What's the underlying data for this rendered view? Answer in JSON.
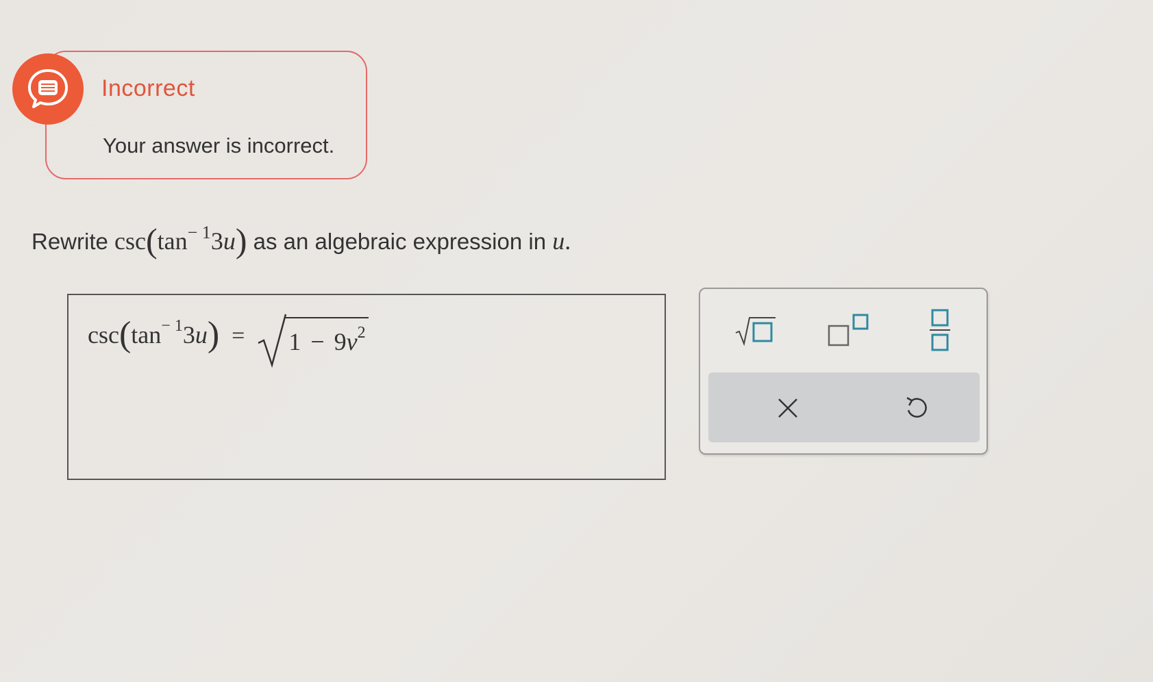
{
  "feedback": {
    "status": "Incorrect",
    "message": "Your answer is incorrect.",
    "icon": "chat-bubble-icon",
    "color": "#ec5a37"
  },
  "question": {
    "prefix": "Rewrite",
    "func": "csc",
    "inner_func": "tan",
    "inner_exp": "− 1",
    "inner_arg_coef": "3",
    "inner_arg_var": "u",
    "suffix": "as an algebraic expression in",
    "var": "u",
    "end": "."
  },
  "answer": {
    "lhs_func": "csc",
    "lhs_inner_func": "tan",
    "lhs_inner_exp": "− 1",
    "lhs_coef": "3",
    "lhs_var": "u",
    "equals": "=",
    "radicand_one": "1",
    "radicand_minus": "−",
    "radicand_coef": "9",
    "radicand_var": "v",
    "radicand_exp": "2"
  },
  "keypad": {
    "keys": [
      "sqrt-icon",
      "superscript-icon",
      "fraction-icon"
    ],
    "actions": [
      "clear-icon",
      "undo-icon"
    ],
    "accent": "#2f8aa0"
  }
}
